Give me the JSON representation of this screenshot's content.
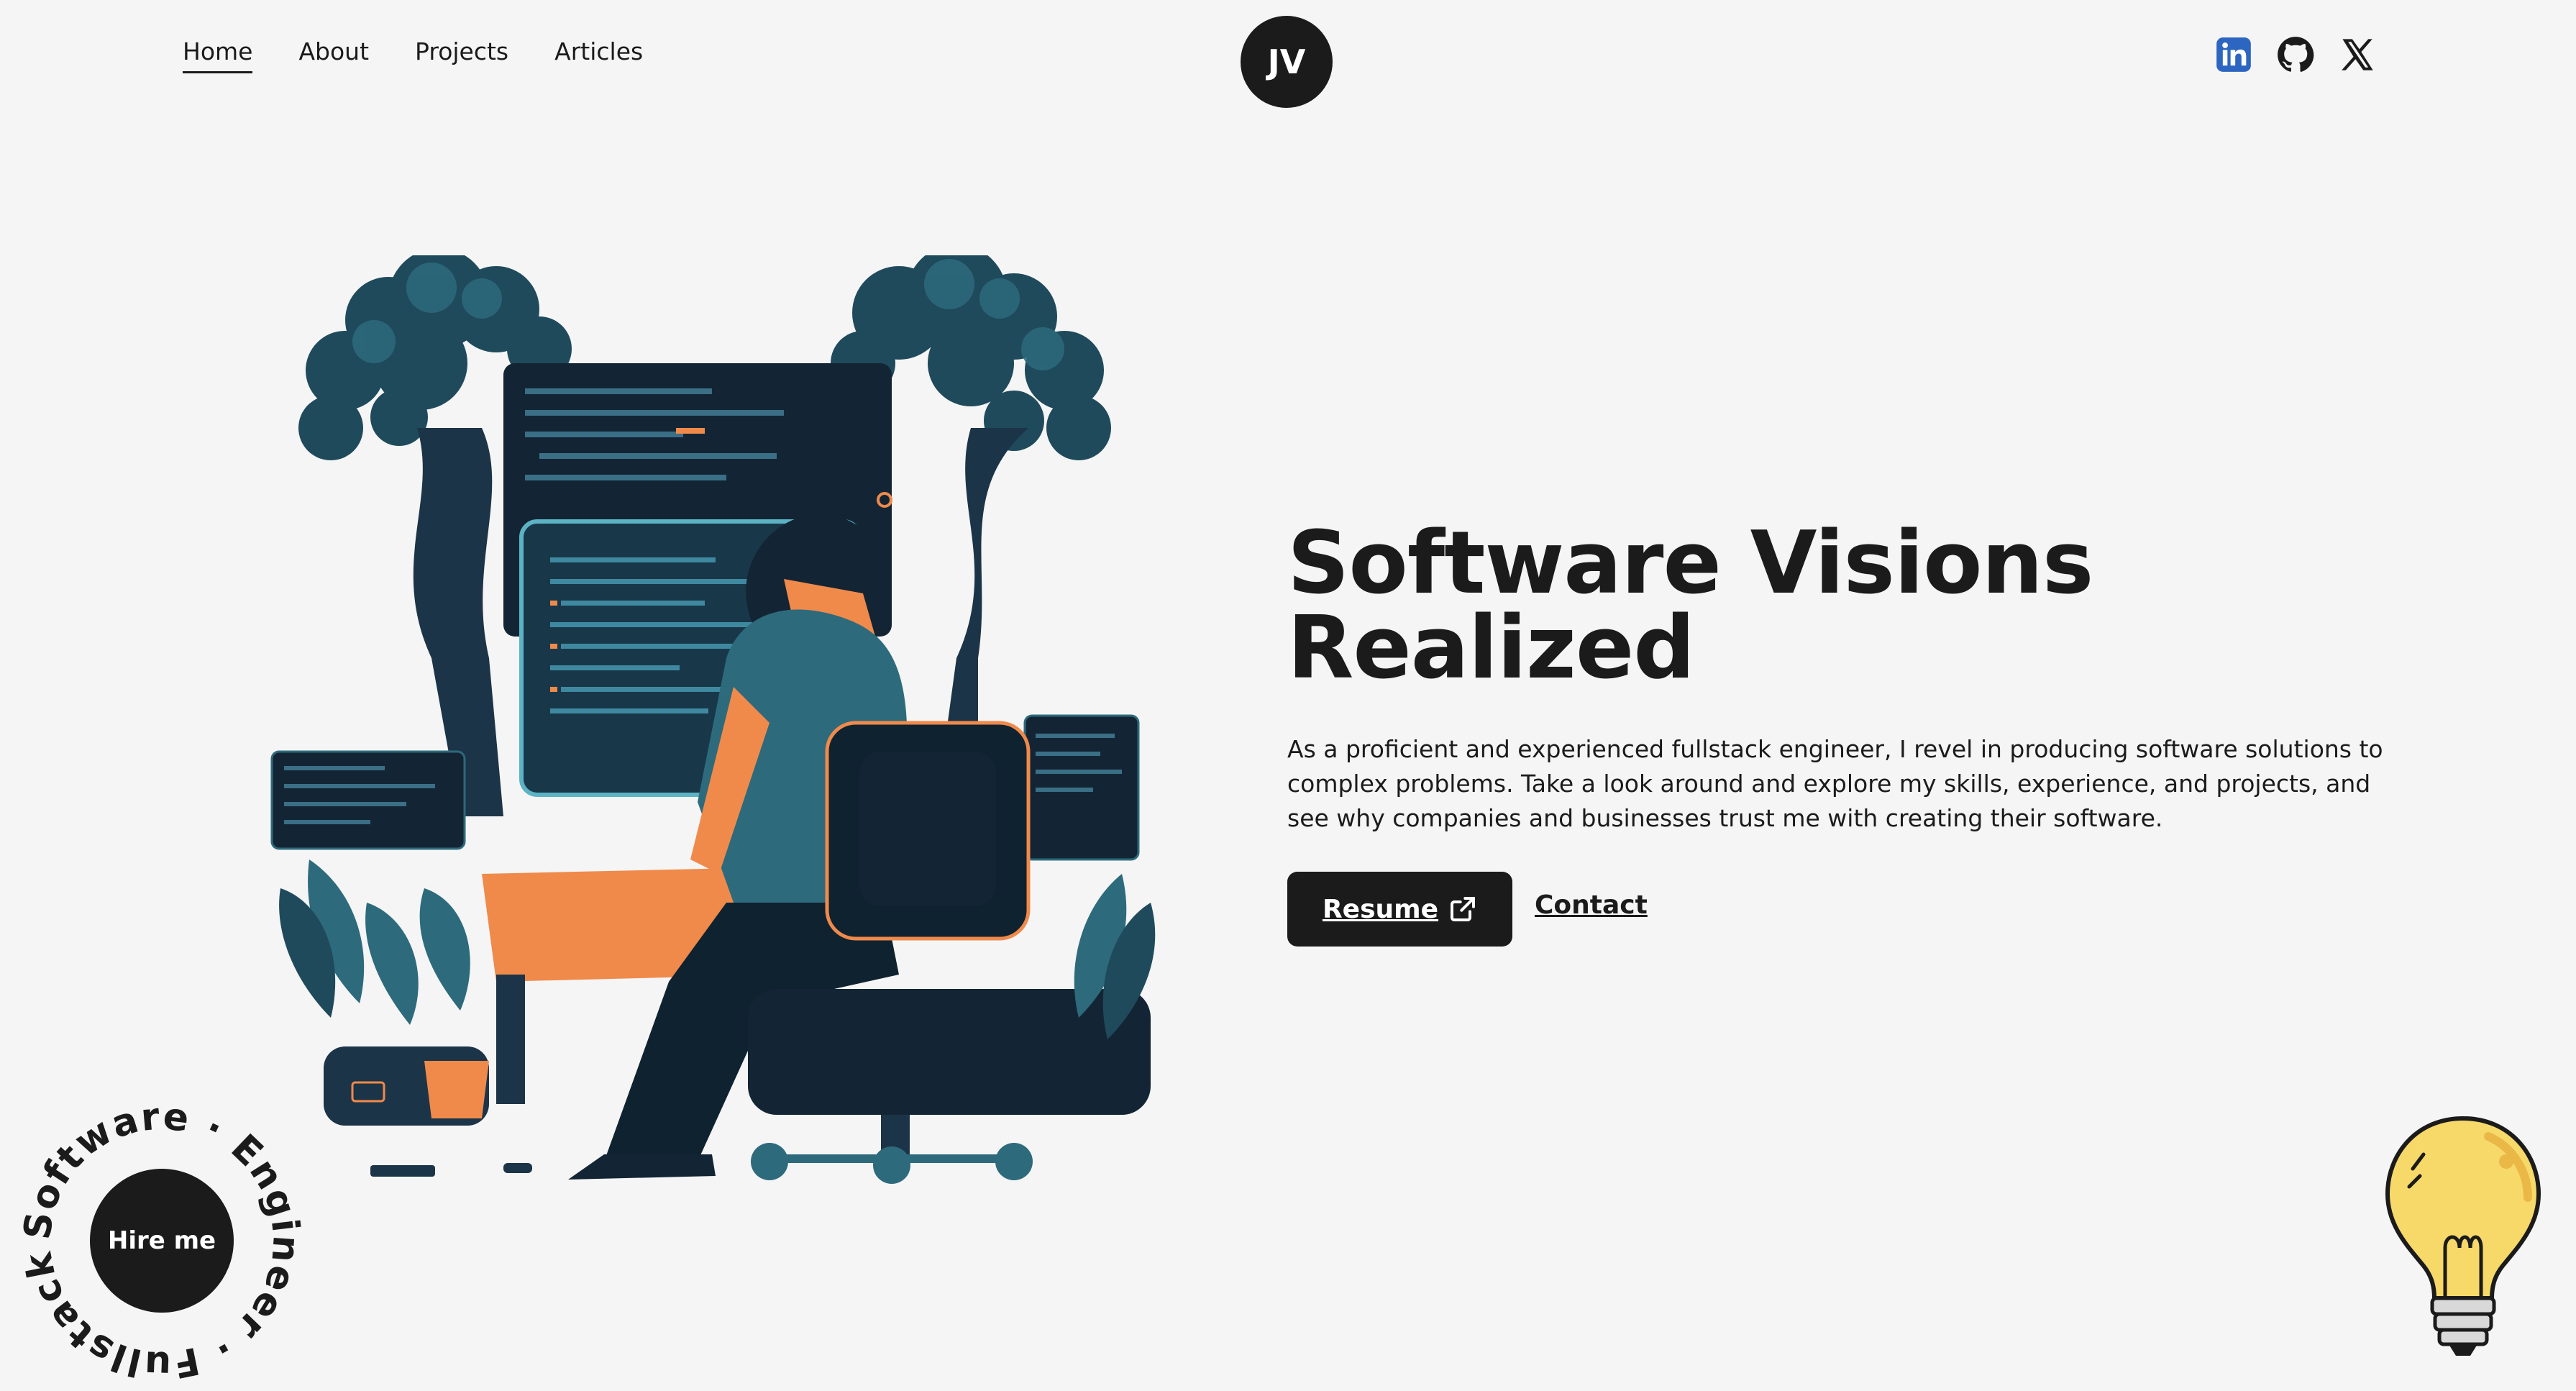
{
  "nav": {
    "items": [
      {
        "label": "Home",
        "active": true
      },
      {
        "label": "About",
        "active": false
      },
      {
        "label": "Projects",
        "active": false
      },
      {
        "label": "Articles",
        "active": false
      }
    ]
  },
  "logo": {
    "initials": "JV"
  },
  "socials": {
    "icons": [
      "linkedin-icon",
      "github-icon",
      "x-icon"
    ]
  },
  "hero": {
    "headline": "Software Visions Realized",
    "description": "As a proficient and experienced fullstack engineer, I revel in producing software solutions to complex problems. Take a look around and explore my skills, experience, and projects, and see why companies and businesses trust me with creating their software.",
    "resume_label": "Resume",
    "contact_label": "Contact"
  },
  "badge": {
    "ring_text": "Software · Engineer · Fullstack ·",
    "button_label": "Hire me"
  },
  "colors": {
    "background": "#f5f5f5",
    "ink": "#1b1b1b",
    "art_navy": "#1c3447",
    "art_teal": "#2d6a7c",
    "art_orange": "#f08a4b",
    "linkedin": "#2c66c0",
    "bulb": "#f7d96a"
  }
}
